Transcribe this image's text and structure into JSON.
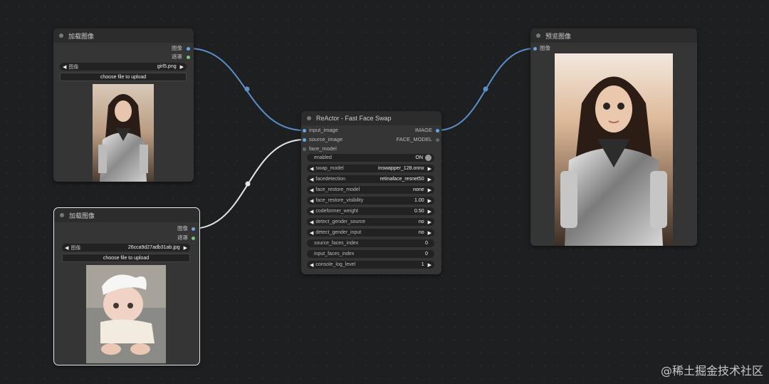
{
  "node_load1": {
    "title": "加载图像",
    "outputs": [
      "图像",
      "遮罩"
    ],
    "widget_label": "图像",
    "widget_value": "girl5.png",
    "upload_label": "choose file to upload"
  },
  "node_load2": {
    "title": "加载图像",
    "outputs": [
      "图像",
      "遮罩"
    ],
    "widget_label": "图像",
    "widget_value": "26cca9d27adb31ab.jpg",
    "upload_label": "choose file to upload"
  },
  "node_reactor": {
    "title": "ReActor - Fast Face Swap",
    "inputs": [
      "input_image",
      "source_image",
      "face_model"
    ],
    "outputs": [
      "IMAGE",
      "FACE_MODEL"
    ],
    "widgets": [
      {
        "label": "enabled",
        "value": "ON",
        "kind": "toggle"
      },
      {
        "label": "swap_model",
        "value": "inswapper_128.onnx",
        "kind": "combo"
      },
      {
        "label": "facedetection",
        "value": "retinaface_resnet50",
        "kind": "combo"
      },
      {
        "label": "face_restore_model",
        "value": "none",
        "kind": "combo"
      },
      {
        "label": "face_restore_visibility",
        "value": "1.00",
        "kind": "combo"
      },
      {
        "label": "codeformer_weight",
        "value": "0.50",
        "kind": "combo"
      },
      {
        "label": "detect_gender_source",
        "value": "no",
        "kind": "combo"
      },
      {
        "label": "detect_gender_input",
        "value": "no",
        "kind": "combo"
      },
      {
        "label": "source_faces_index",
        "value": "0",
        "kind": "text"
      },
      {
        "label": "input_faces_index",
        "value": "0",
        "kind": "text"
      },
      {
        "label": "console_log_level",
        "value": "1",
        "kind": "combo"
      }
    ]
  },
  "node_preview": {
    "title": "预览图像",
    "inputs": [
      "图像"
    ]
  },
  "colors": {
    "wire_image": "#5b8fc9",
    "wire_source": "#e6e6e6",
    "port_image": "#64a8e8",
    "port_mask": "#7dc27d"
  },
  "watermark": "@稀土掘金技术社区"
}
